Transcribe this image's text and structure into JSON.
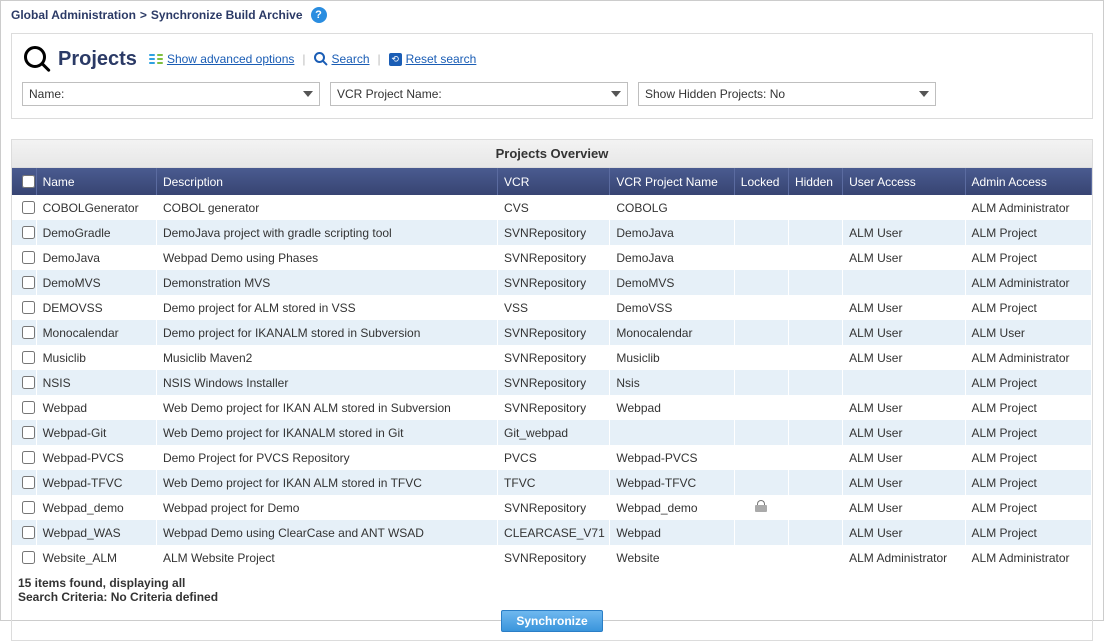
{
  "breadcrumb": {
    "section": "Global Administration",
    "separator": ">",
    "page": "Synchronize Build Archive"
  },
  "search": {
    "title": "Projects",
    "advanced_label": "Show advanced options",
    "search_label": " Search",
    "reset_label": " Reset search",
    "name_combo": "Name:",
    "vcr_combo": "VCR Project Name:",
    "hidden_combo": "Show Hidden Projects: No"
  },
  "table": {
    "title": "Projects Overview",
    "headers": {
      "name": "Name",
      "description": "Description",
      "vcr": "VCR",
      "vcr_project": "VCR Project Name",
      "locked": "Locked",
      "hidden": "Hidden",
      "user_access": "User Access",
      "admin_access": "Admin Access"
    },
    "rows": [
      {
        "name": "COBOLGenerator",
        "description": "COBOL generator",
        "vcr": "CVS",
        "vcr_project": "COBOLG",
        "locked": false,
        "hidden": "",
        "user_access": "",
        "admin_access": "ALM Administrator"
      },
      {
        "name": "DemoGradle",
        "description": "DemoJava project with gradle scripting tool",
        "vcr": "SVNRepository",
        "vcr_project": "DemoJava",
        "locked": false,
        "hidden": "",
        "user_access": "ALM User",
        "admin_access": "ALM Project"
      },
      {
        "name": "DemoJava",
        "description": "Webpad Demo using Phases",
        "vcr": "SVNRepository",
        "vcr_project": "DemoJava",
        "locked": false,
        "hidden": "",
        "user_access": "ALM User",
        "admin_access": "ALM Project"
      },
      {
        "name": "DemoMVS",
        "description": "Demonstration MVS",
        "vcr": "SVNRepository",
        "vcr_project": "DemoMVS",
        "locked": false,
        "hidden": "",
        "user_access": "",
        "admin_access": "ALM Administrator"
      },
      {
        "name": "DEMOVSS",
        "description": "Demo project for ALM stored in VSS",
        "vcr": "VSS",
        "vcr_project": "DemoVSS",
        "locked": false,
        "hidden": "",
        "user_access": "ALM User",
        "admin_access": "ALM Project"
      },
      {
        "name": "Monocalendar",
        "description": "Demo project for IKANALM stored in Subversion",
        "vcr": "SVNRepository",
        "vcr_project": "Monocalendar",
        "locked": false,
        "hidden": "",
        "user_access": "ALM User",
        "admin_access": "ALM User"
      },
      {
        "name": "Musiclib",
        "description": "Musiclib Maven2",
        "vcr": "SVNRepository",
        "vcr_project": "Musiclib",
        "locked": false,
        "hidden": "",
        "user_access": "ALM User",
        "admin_access": "ALM Administrator"
      },
      {
        "name": "NSIS",
        "description": "NSIS Windows Installer",
        "vcr": "SVNRepository",
        "vcr_project": "Nsis",
        "locked": false,
        "hidden": "",
        "user_access": "",
        "admin_access": "ALM Project"
      },
      {
        "name": "Webpad",
        "description": "Web Demo project for IKAN ALM stored in Subversion",
        "vcr": "SVNRepository",
        "vcr_project": "Webpad",
        "locked": false,
        "hidden": "",
        "user_access": "ALM User",
        "admin_access": "ALM Project"
      },
      {
        "name": "Webpad-Git",
        "description": "Web Demo project for IKANALM stored in Git",
        "vcr": "Git_webpad",
        "vcr_project": "",
        "locked": false,
        "hidden": "",
        "user_access": "ALM User",
        "admin_access": "ALM Project"
      },
      {
        "name": "Webpad-PVCS",
        "description": "Demo Project for PVCS Repository",
        "vcr": "PVCS",
        "vcr_project": "Webpad-PVCS",
        "locked": false,
        "hidden": "",
        "user_access": "ALM User",
        "admin_access": "ALM Project"
      },
      {
        "name": "Webpad-TFVC",
        "description": "Web Demo project for IKAN ALM stored in TFVC",
        "vcr": "TFVC",
        "vcr_project": "Webpad-TFVC",
        "locked": false,
        "hidden": "",
        "user_access": "ALM User",
        "admin_access": "ALM Project"
      },
      {
        "name": "Webpad_demo",
        "description": "Webpad project for Demo",
        "vcr": "SVNRepository",
        "vcr_project": "Webpad_demo",
        "locked": true,
        "hidden": "",
        "user_access": "ALM User",
        "admin_access": "ALM Project"
      },
      {
        "name": "Webpad_WAS",
        "description": "Webpad Demo using ClearCase and ANT WSAD",
        "vcr": "CLEARCASE_V71",
        "vcr_project": "Webpad",
        "locked": false,
        "hidden": "",
        "user_access": "ALM User",
        "admin_access": "ALM Project"
      },
      {
        "name": "Website_ALM",
        "description": "ALM Website Project",
        "vcr": "SVNRepository",
        "vcr_project": "Website",
        "locked": false,
        "hidden": "",
        "user_access": "ALM Administrator",
        "admin_access": "ALM Administrator"
      }
    ],
    "footer_count": "15 items found, displaying all",
    "footer_criteria": "Search Criteria: No Criteria defined",
    "sync_button": "Synchronize"
  }
}
